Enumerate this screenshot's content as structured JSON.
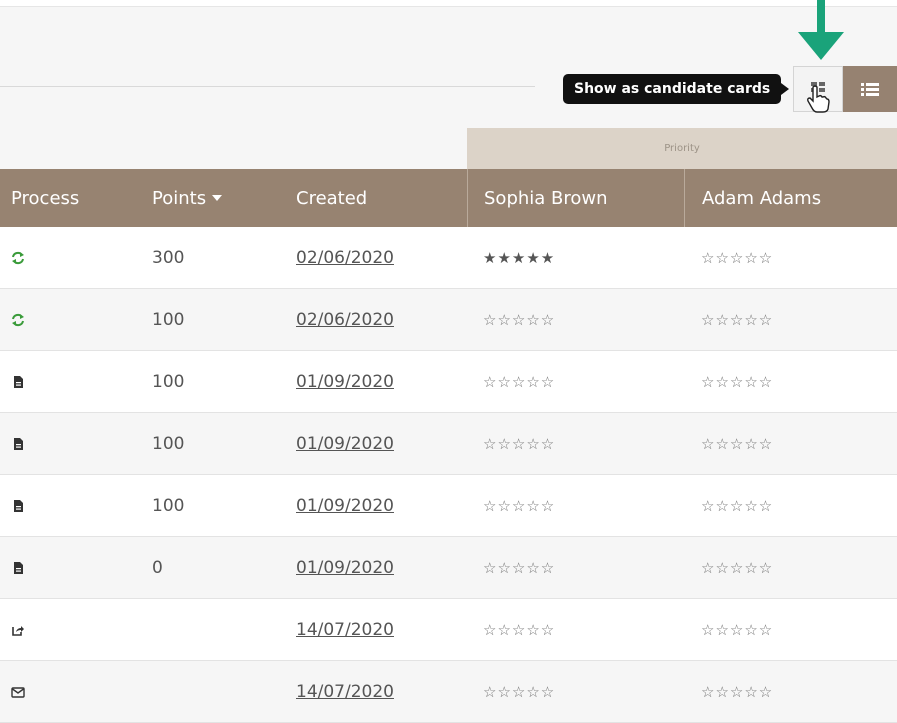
{
  "tooltip": "Show as candidate cards",
  "priority_label": "Priority",
  "colors": {
    "header": "#978371",
    "priority_band": "#dcd3c8",
    "arrow": "#1aa37a",
    "process_green": "#3a9b3a"
  },
  "columns": [
    "Process",
    "Points",
    "Created",
    "Sophia Brown",
    "Adam Adams"
  ],
  "rows": [
    {
      "process_icon": "sync-icon",
      "points": "300",
      "created": "02/06/2020",
      "sophia": "★★★★★",
      "adam": "☆☆☆☆☆",
      "sophia_filled": true
    },
    {
      "process_icon": "sync-icon",
      "points": "100",
      "created": "02/06/2020",
      "sophia": "☆☆☆☆☆",
      "adam": "☆☆☆☆☆"
    },
    {
      "process_icon": "document-icon",
      "points": "100",
      "created": "01/09/2020",
      "sophia": "☆☆☆☆☆",
      "adam": "☆☆☆☆☆"
    },
    {
      "process_icon": "document-icon",
      "points": "100",
      "created": "01/09/2020",
      "sophia": "☆☆☆☆☆",
      "adam": "☆☆☆☆☆"
    },
    {
      "process_icon": "document-icon",
      "points": "100",
      "created": "01/09/2020",
      "sophia": "☆☆☆☆☆",
      "adam": "☆☆☆☆☆"
    },
    {
      "process_icon": "document-icon",
      "points": "0",
      "created": "01/09/2020",
      "sophia": "☆☆☆☆☆",
      "adam": "☆☆☆☆☆"
    },
    {
      "process_icon": "share-icon",
      "points": "",
      "created": "14/07/2020",
      "sophia": "☆☆☆☆☆",
      "adam": "☆☆☆☆☆"
    },
    {
      "process_icon": "envelope-icon",
      "points": "",
      "created": "14/07/2020",
      "sophia": "☆☆☆☆☆",
      "adam": "☆☆☆☆☆"
    }
  ]
}
